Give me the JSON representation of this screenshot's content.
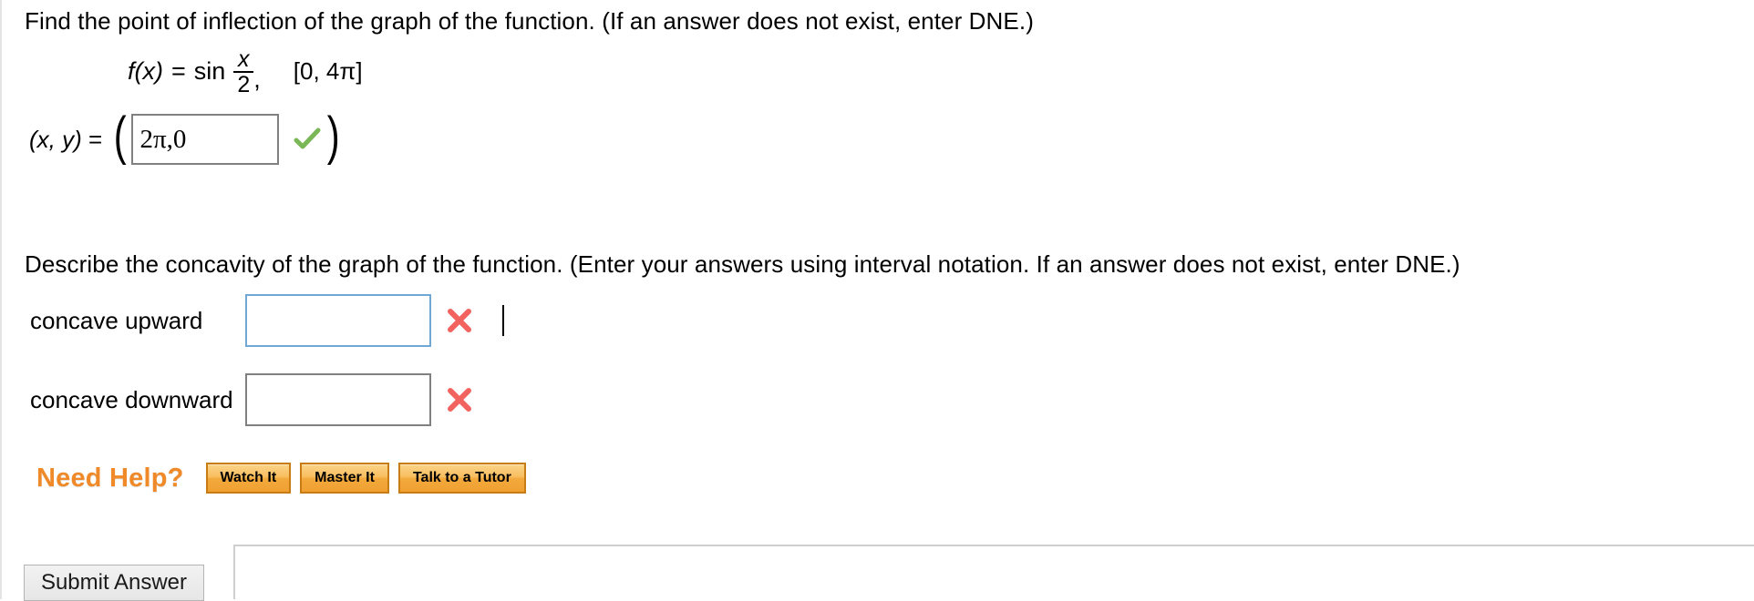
{
  "question_inflection": {
    "prompt": "Find the point of inflection of the graph of the function. (If an answer does not exist, enter DNE.)",
    "function": {
      "name": "f(x)",
      "equals": "=",
      "operator": "sin",
      "numerator": "x",
      "denominator": "2",
      "comma": ",",
      "interval": "[0, 4π]"
    },
    "answer": {
      "label_open": "(x, y)",
      "label_equals": "=",
      "paren_left": "(",
      "paren_right": ")",
      "value": "2π,0",
      "placeholder": "",
      "status_icon": "green-check-icon",
      "status_color": "#7ab857"
    }
  },
  "question_concavity": {
    "prompt": "Describe the concavity of the graph of the function. (Enter your answers using interval notation. If an answer does not exist, enter DNE.)",
    "rows": [
      {
        "label": "concave upward",
        "value": "",
        "placeholder": "",
        "focused": true,
        "status_icon": "red-x-icon",
        "status_color": "#f2635f"
      },
      {
        "label": "concave downward",
        "value": "",
        "placeholder": "",
        "focused": false,
        "status_icon": "red-x-icon",
        "status_color": "#f2635f"
      }
    ]
  },
  "need_help": {
    "label": "Need Help?",
    "label_color": "#f08a28",
    "buttons": [
      {
        "label": "Watch It"
      },
      {
        "label": "Master It"
      },
      {
        "label": "Talk to a Tutor"
      }
    ]
  },
  "footer": {
    "submit_label": "Submit Answer"
  }
}
